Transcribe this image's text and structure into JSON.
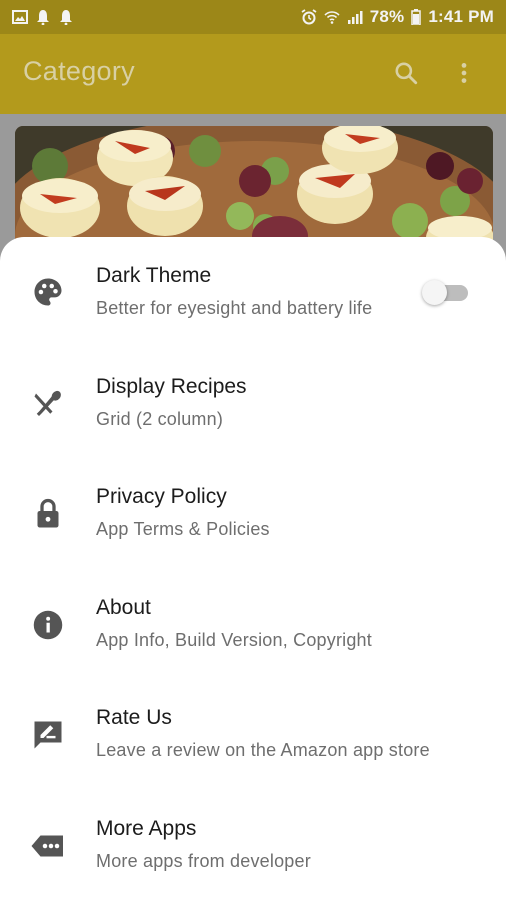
{
  "status_bar": {
    "battery": "78%",
    "time": "1:41 PM",
    "icons_left": [
      "image-icon",
      "bell-icon",
      "bell-icon"
    ],
    "icons_right": [
      "alarm-icon",
      "wifi-icon",
      "signal-icon",
      "battery-icon"
    ]
  },
  "app_bar": {
    "title": "Category",
    "actions": [
      "search-icon",
      "more-vertical-icon"
    ]
  },
  "colors": {
    "status_bar": "#9c8718",
    "app_bar": "#b39a1c",
    "scrim": "#9a9a9a",
    "sheet": "#ffffff",
    "icon": "#5a5a5a"
  },
  "settings": {
    "items": [
      {
        "icon": "palette-icon",
        "title": "Dark Theme",
        "subtitle": "Better for eyesight and battery life",
        "toggle": false
      },
      {
        "icon": "utensils-icon",
        "title": "Display Recipes",
        "subtitle": "Grid (2 column)"
      },
      {
        "icon": "lock-icon",
        "title": "Privacy Policy",
        "subtitle": "App Terms & Policies"
      },
      {
        "icon": "info-icon",
        "title": "About",
        "subtitle": "App Info, Build Version, Copyright"
      },
      {
        "icon": "rate-review-icon",
        "title": "Rate Us",
        "subtitle": "Leave a review on the Amazon app store"
      },
      {
        "icon": "more-apps-icon",
        "title": "More Apps",
        "subtitle": "More apps from developer"
      }
    ]
  }
}
